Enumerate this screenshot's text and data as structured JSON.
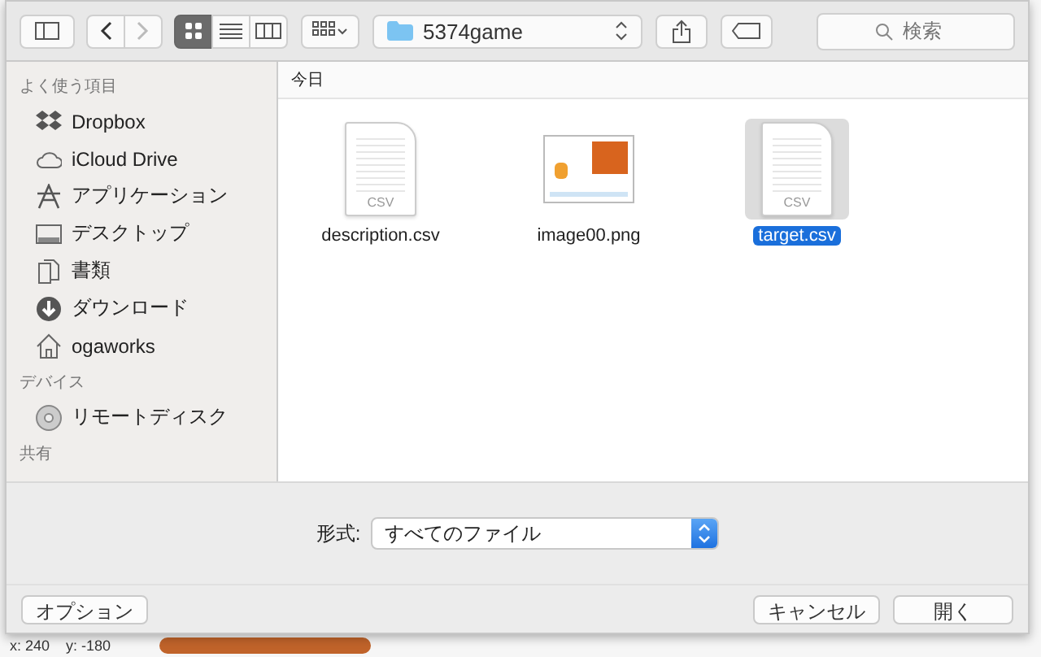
{
  "toolbar": {
    "view_modes": [
      {
        "kind": "icons",
        "selected": true
      },
      {
        "kind": "list",
        "selected": false
      },
      {
        "kind": "columns",
        "selected": false
      }
    ],
    "path": "5374game",
    "search": {
      "placeholder": "検索"
    }
  },
  "sidebar": [
    {
      "heading": "よく使う項目",
      "items": [
        {
          "label": "Dropbox"
        },
        {
          "label": "iCloud Drive"
        },
        {
          "label": "アプリケーション"
        },
        {
          "label": "デスクトップ"
        },
        {
          "label": "書類"
        },
        {
          "label": "ダウンロード"
        },
        {
          "label": "ogaworks"
        }
      ]
    },
    {
      "heading": "デバイス",
      "items": [
        {
          "label": "リモートディスク"
        }
      ]
    },
    {
      "heading": "共有"
    }
  ],
  "content": {
    "group_header": "今日",
    "files": [
      {
        "name": "description.csv",
        "kind": "csv",
        "badge": "CSV",
        "selected": false
      },
      {
        "name": "image00.png",
        "kind": "png",
        "selected": false
      },
      {
        "name": "target.csv",
        "kind": "csv",
        "badge": "CSV",
        "selected": true
      }
    ]
  },
  "format": {
    "label": "形式:",
    "value": "すべてのファイル"
  },
  "buttons": {
    "options": "オプション",
    "cancel": "キャンセル",
    "open": "開く"
  },
  "background": {
    "x": "x: 240",
    "y": "y: -180"
  }
}
